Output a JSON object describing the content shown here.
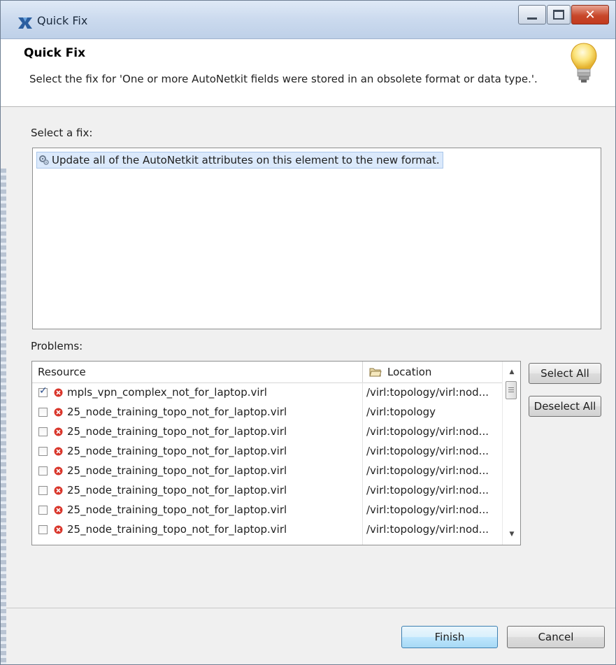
{
  "window": {
    "title": "Quick Fix"
  },
  "header": {
    "title": "Quick Fix",
    "description": "Select the fix for 'One or more AutoNetkit fields were stored in an obsolete format or data type.'."
  },
  "fixes": {
    "label": "Select a fix:",
    "items": [
      "Update all of the AutoNetkit attributes on this element to the new format."
    ]
  },
  "problems": {
    "label": "Problems:",
    "columns": [
      "Resource",
      "Location"
    ],
    "rows": [
      {
        "checked": true,
        "resource": "mpls_vpn_complex_not_for_laptop.virl",
        "location": "/virl:topology/virl:nod..."
      },
      {
        "checked": false,
        "resource": "25_node_training_topo_not_for_laptop.virl",
        "location": "/virl:topology"
      },
      {
        "checked": false,
        "resource": "25_node_training_topo_not_for_laptop.virl",
        "location": "/virl:topology/virl:nod..."
      },
      {
        "checked": false,
        "resource": "25_node_training_topo_not_for_laptop.virl",
        "location": "/virl:topology/virl:nod..."
      },
      {
        "checked": false,
        "resource": "25_node_training_topo_not_for_laptop.virl",
        "location": "/virl:topology/virl:nod..."
      },
      {
        "checked": false,
        "resource": "25_node_training_topo_not_for_laptop.virl",
        "location": "/virl:topology/virl:nod..."
      },
      {
        "checked": false,
        "resource": "25_node_training_topo_not_for_laptop.virl",
        "location": "/virl:topology/virl:nod..."
      },
      {
        "checked": false,
        "resource": "25_node_training_topo_not_for_laptop.virl",
        "location": "/virl:topology/virl:nod..."
      }
    ],
    "select_all_label": "Select All",
    "deselect_all_label": "Deselect All"
  },
  "footer": {
    "finish_label": "Finish",
    "cancel_label": "Cancel"
  },
  "colors": {
    "titlebar": "#cbdaee",
    "close_button": "#c8482b",
    "selection": "#dbe9fb",
    "error": "#d9362b",
    "finish_button": "#bee6fd"
  },
  "icons": {
    "app": "cisco-virl-icon",
    "header": "lightbulb-icon",
    "fix": "gear-quickfix-icon",
    "location_column": "folder-icon",
    "row_status": "error-icon"
  }
}
